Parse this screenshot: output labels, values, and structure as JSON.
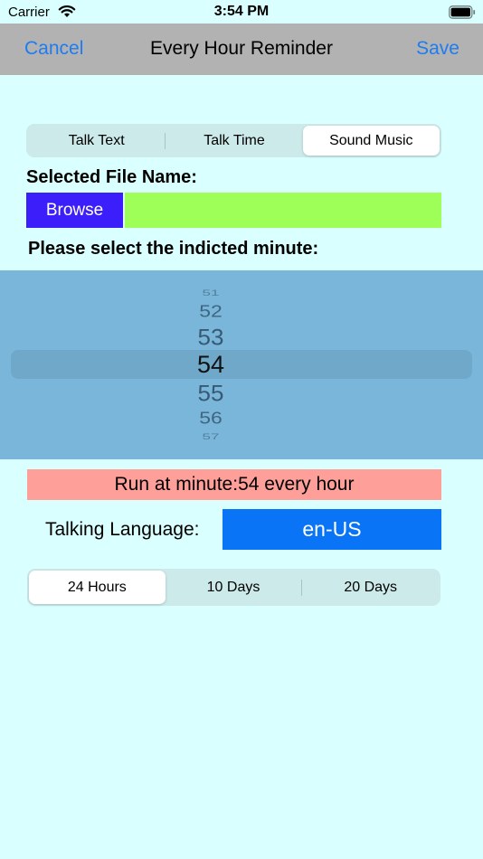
{
  "status_bar": {
    "carrier": "Carrier",
    "time": "3:54 PM",
    "wifi_icon": "wifi-icon",
    "battery_icon": "battery-icon"
  },
  "nav": {
    "cancel": "Cancel",
    "title": "Every Hour Reminder",
    "save": "Save",
    "accent_color": "#1e7cf2"
  },
  "mode_tabs": {
    "items": [
      "Talk Text",
      "Talk Time",
      "Sound Music"
    ],
    "selected": "Sound Music"
  },
  "file": {
    "label": "Selected File Name:",
    "browse": "Browse",
    "value": ""
  },
  "minute": {
    "label": "Please select the indicted minute:",
    "picker_values": [
      "51",
      "52",
      "53",
      "54",
      "55",
      "56",
      "57"
    ],
    "selected": "54"
  },
  "run_banner": "Run at minute:54 every hour",
  "language": {
    "label": "Talking Language:",
    "value": "en-US"
  },
  "duration_tabs": {
    "items": [
      "24 Hours",
      "10 Days",
      "20 Days"
    ],
    "selected": "24 Hours"
  },
  "colors": {
    "background": "#d9ffff",
    "browse": "#3c1efa",
    "file_field": "#9dff57",
    "picker": "#7ab6d9",
    "run_banner": "#ff9f9a",
    "language_button": "#0a74f7"
  }
}
